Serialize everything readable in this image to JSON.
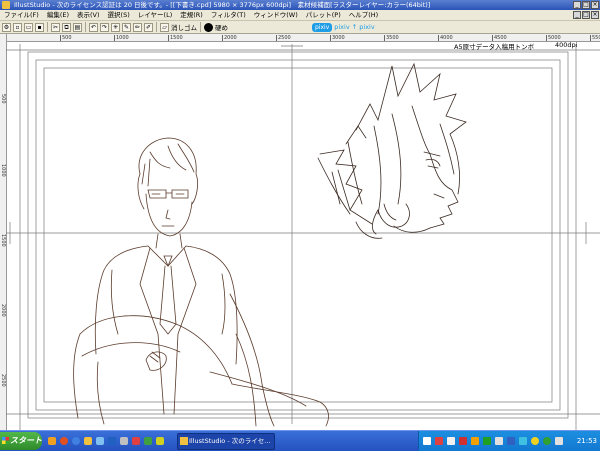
{
  "window": {
    "title": "IllustStudio - 次のライセンス認証は 20 日後です。- [[下書き.cpd] 5980 × 3776px 600dpi]　素材候補面[ラスターレイヤー:カラー(64bit)]"
  },
  "menu": {
    "items": [
      "ファイル(F)",
      "編集(E)",
      "表示(V)",
      "選択(S)",
      "レイヤー(L)",
      "定規(R)",
      "フィルタ(T)",
      "ウィンドウ(W)",
      "パレット(P)",
      "ヘルプ(H)"
    ]
  },
  "toolbar": {
    "eraser_label": "消しゴム",
    "brush_label": "硬め",
    "pixiv_label": "pixiv",
    "pixiv_link_label": "pixiv ↑ pixiv"
  },
  "ruler": {
    "top_ticks": [
      "500",
      "1000",
      "1500",
      "2000",
      "2500",
      "3000",
      "3500",
      "4000",
      "4500",
      "5000",
      "5500"
    ],
    "left_ticks": [
      "500",
      "1000",
      "1500",
      "2000",
      "2500"
    ]
  },
  "page": {
    "template_label": "A5原寸データ入稿用トンボ",
    "resolution_label": "400dpi"
  },
  "taskbar": {
    "start_label": "スタート",
    "active_task_label": "IllustStudio - 次のライセ...",
    "clock": "21:53"
  },
  "colors": {
    "titlebar": "#2b54b8",
    "chrome": "#ece9d8",
    "sketch_line": "#5a3a2a",
    "guide_line": "#7a7a7a"
  }
}
